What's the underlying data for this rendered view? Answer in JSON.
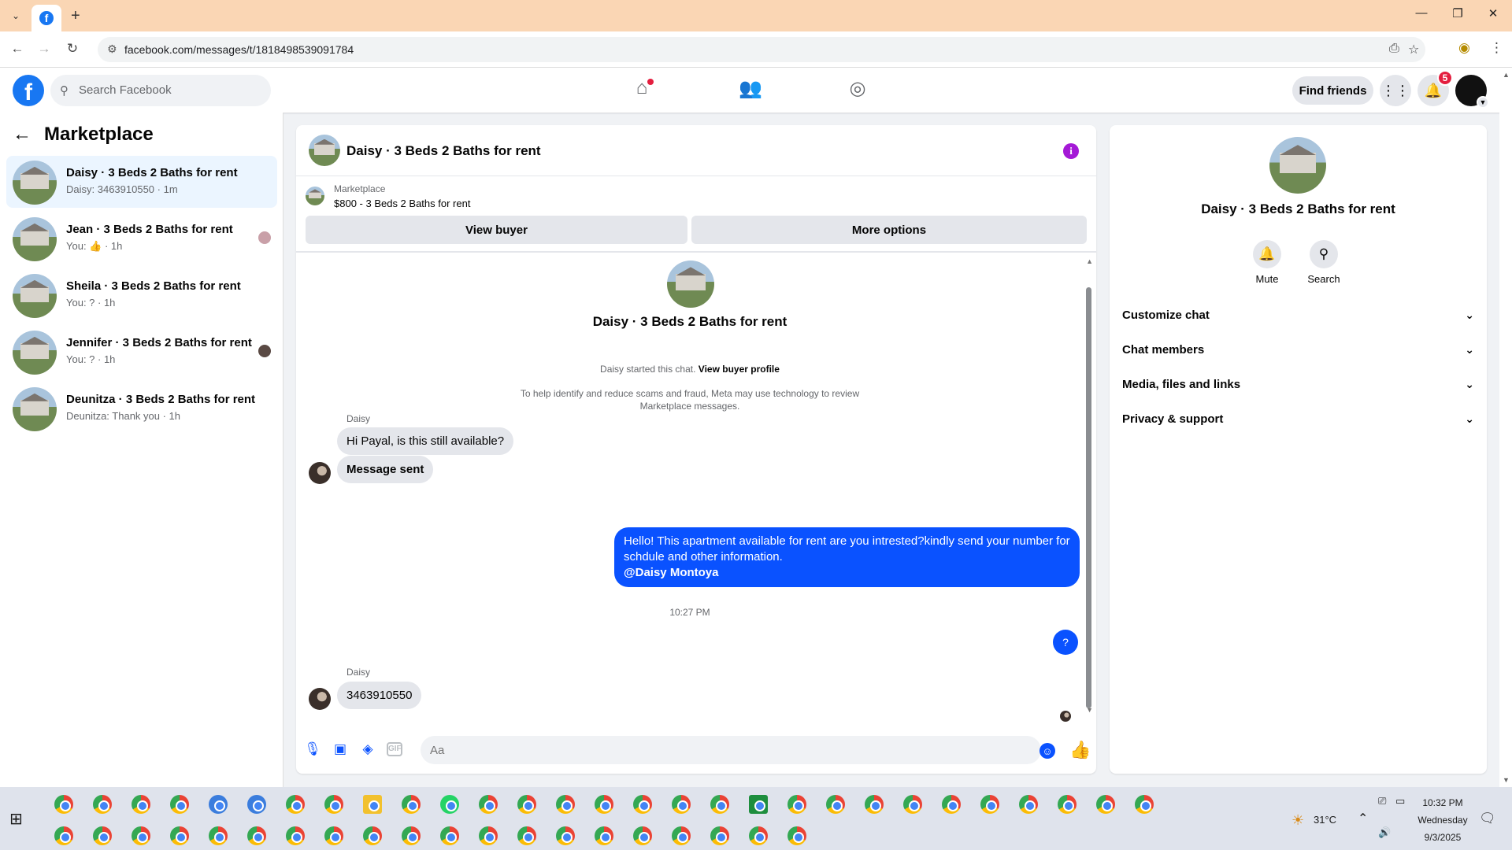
{
  "browser": {
    "url": "facebook.com/messages/t/1818498539091784"
  },
  "fb_header": {
    "search_placeholder": "Search Facebook",
    "find_friends_label": "Find friends",
    "notifications_count": "5"
  },
  "sidebar": {
    "title": "Marketplace",
    "conversations": [
      {
        "name": "Daisy · 3 Beds 2 Baths for rent",
        "preview": "Daisy: 3463910550 · 1m"
      },
      {
        "name": "Jean · 3 Beds 2 Baths for rent",
        "preview": "You: 👍 · 1h"
      },
      {
        "name": "Sheila · 3 Beds 2 Baths for rent",
        "preview": "You: ? · 1h"
      },
      {
        "name": "Jennifer · 3 Beds 2 Baths for rent",
        "preview": "You: ? · 1h"
      },
      {
        "name": "Deunitza · 3 Beds 2 Baths for rent",
        "preview": "Deunitza: Thank you · 1h"
      }
    ]
  },
  "chat": {
    "title": "Daisy · 3 Beds 2 Baths for rent",
    "marketplace_label": "Marketplace",
    "listing": "$800 - 3 Beds 2 Baths for rent",
    "view_buyer_label": "View buyer",
    "more_options_label": "More options",
    "intro_name": "Daisy · 3 Beds 2 Baths for rent",
    "started_text": "Daisy started this chat.",
    "view_buyer_profile_label": "View buyer profile",
    "notice": "To help identify and reduce scams and fraud, Meta may use technology to review Marketplace messages.",
    "messages": [
      {
        "sender": "Daisy",
        "text": "Hi Payal, is this still available?"
      },
      {
        "text": "Message sent"
      },
      {
        "text": "Hello! This apartment available for rent are you intrested?kindly send your number for schdule and other information.",
        "mention": "@Daisy Montoya"
      },
      {
        "text": "?"
      },
      {
        "sender": "Daisy",
        "text": "3463910550"
      }
    ],
    "timestamp": "10:27 PM",
    "composer_placeholder": "Aa"
  },
  "details": {
    "name": "Daisy · 3 Beds 2 Baths for rent",
    "mute_label": "Mute",
    "search_label": "Search",
    "sections": [
      "Customize chat",
      "Chat members",
      "Media, files and links",
      "Privacy & support"
    ]
  },
  "taskbar": {
    "temperature": "31°C",
    "time": "10:32 PM",
    "day": "Wednesday",
    "date": "9/3/2025"
  },
  "colors": {
    "brand": "#1877f2",
    "outgoing_bubble": "#0a52ff",
    "tab_strip": "#fad6b4"
  }
}
